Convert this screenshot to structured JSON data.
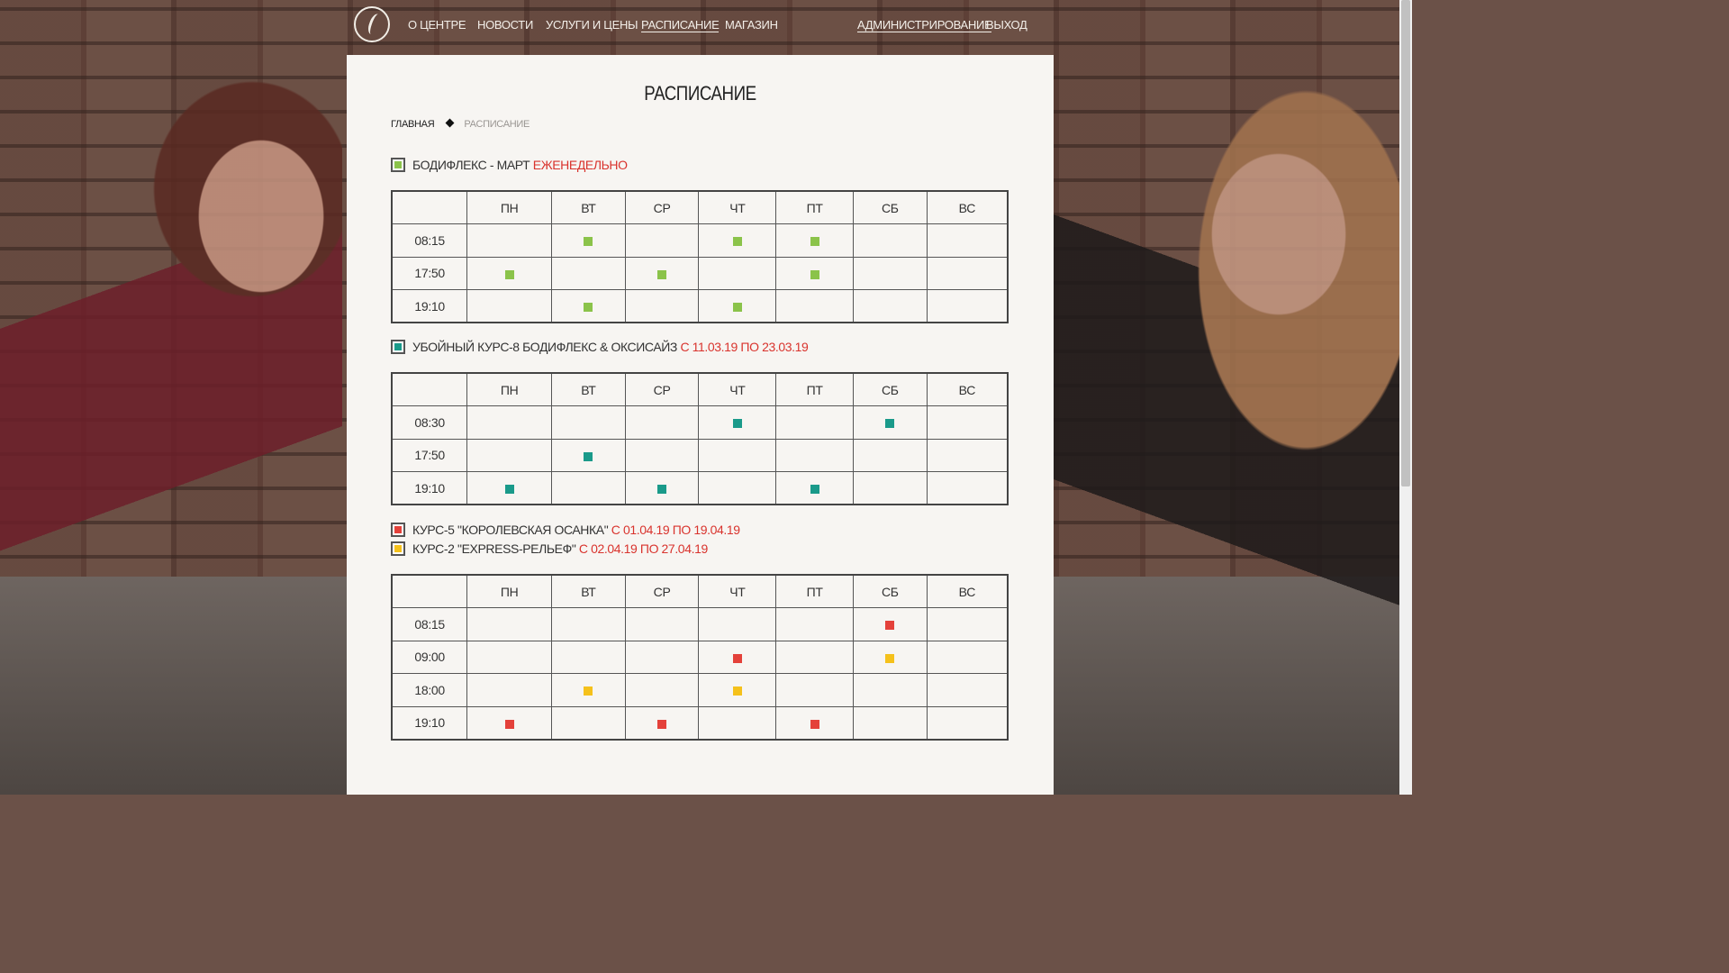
{
  "nav": {
    "items": [
      "О ЦЕНТРЕ",
      "НОВОСТИ",
      "УСЛУГИ И ЦЕНЫ",
      "РАСПИСАНИЕ",
      "МАГАЗИН",
      "АДМИНИСТРИРОВАНИЕ",
      "ВЫХОД"
    ],
    "active": "РАСПИСАНИЕ"
  },
  "page": {
    "title": "РАСПИСАНИЕ",
    "breadcrumb": {
      "home": "ГЛАВНАЯ",
      "current": "РАСПИСАНИЕ"
    }
  },
  "colors": {
    "green": "#8bc34a",
    "teal": "#1a9a8a",
    "red": "#e4413a",
    "yellow": "#f5c11b",
    "highlight": "#d9332d"
  },
  "days": [
    "ПН",
    "ВТ",
    "СР",
    "ЧТ",
    "ПТ",
    "СБ",
    "ВС"
  ],
  "schedules": [
    {
      "legends": [
        {
          "name": "БОДИФЛЕКС - МАРТ",
          "period": "ЕЖЕНЕДЕЛЬНО",
          "color": "green"
        }
      ],
      "rows": [
        {
          "time": "08:15",
          "cells": [
            "",
            "green",
            "",
            "green",
            "green",
            "",
            ""
          ]
        },
        {
          "time": "17:50",
          "cells": [
            "green",
            "",
            "green",
            "",
            "green",
            "",
            ""
          ]
        },
        {
          "time": "19:10",
          "cells": [
            "",
            "green",
            "",
            "green",
            "",
            "",
            ""
          ]
        }
      ]
    },
    {
      "legends": [
        {
          "name": "УБОЙНЫЙ КУРС-8 БОДИФЛЕКС & ОКСИСАЙЗ",
          "period": "С 11.03.19 ПО 23.03.19",
          "color": "teal"
        }
      ],
      "rows": [
        {
          "time": "08:30",
          "cells": [
            "",
            "",
            "",
            "teal",
            "",
            "teal",
            ""
          ]
        },
        {
          "time": "17:50",
          "cells": [
            "",
            "teal",
            "",
            "",
            "",
            "",
            ""
          ]
        },
        {
          "time": "19:10",
          "cells": [
            "teal",
            "",
            "teal",
            "",
            "teal",
            "",
            ""
          ]
        }
      ]
    },
    {
      "legends": [
        {
          "name": "КУРС-5 \"КОРОЛЕВСКАЯ ОСАНКА\"",
          "period": "С 01.04.19 ПО 19.04.19",
          "color": "red"
        },
        {
          "name": "КУРС-2 \"EXPRESS-РЕЛЬЕФ\"",
          "period": "С 02.04.19 ПО 27.04.19",
          "color": "yellow"
        }
      ],
      "rows": [
        {
          "time": "08:15",
          "cells": [
            "",
            "",
            "",
            "",
            "",
            "red",
            ""
          ]
        },
        {
          "time": "09:00",
          "cells": [
            "",
            "",
            "",
            "red",
            "",
            "yellow",
            ""
          ]
        },
        {
          "time": "18:00",
          "cells": [
            "",
            "yellow",
            "",
            "yellow",
            "",
            "",
            ""
          ]
        },
        {
          "time": "19:10",
          "cells": [
            "red",
            "",
            "red",
            "",
            "red",
            "",
            ""
          ]
        }
      ]
    }
  ]
}
